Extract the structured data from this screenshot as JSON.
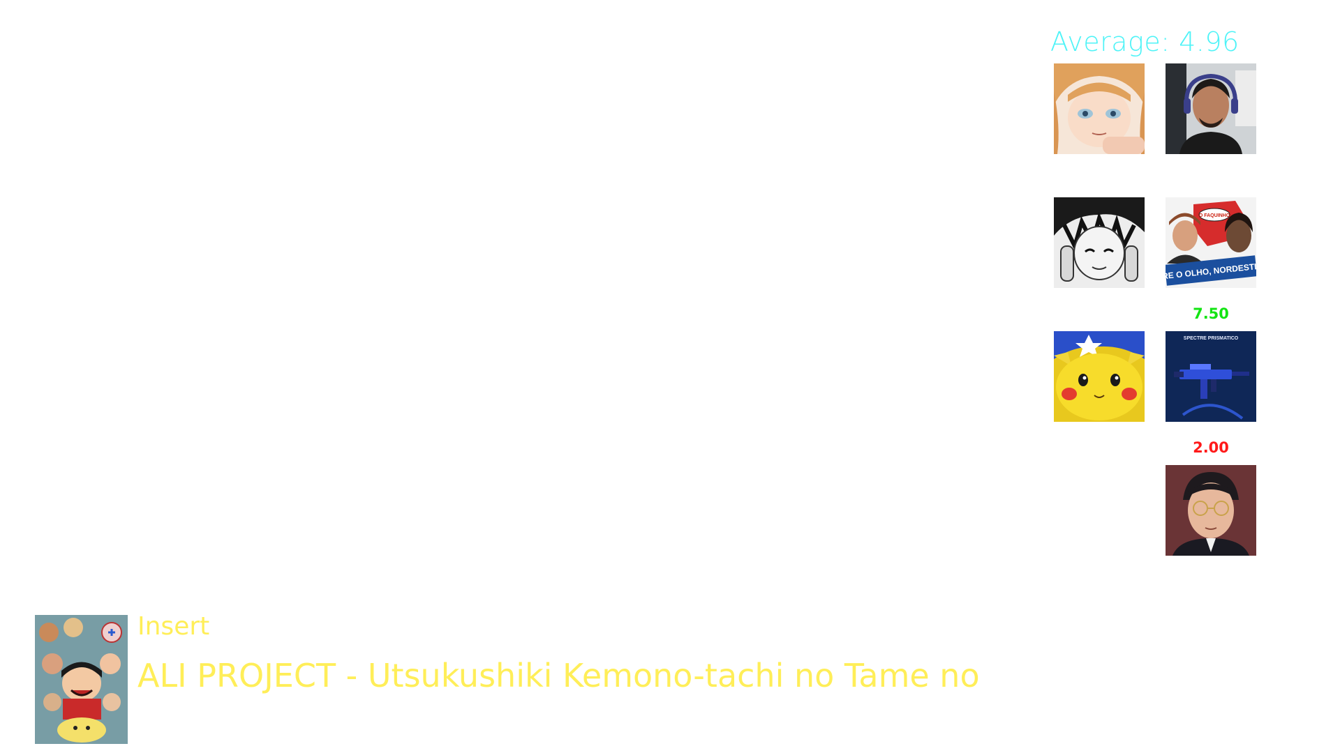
{
  "colors": {
    "average_text": "#4df3f7",
    "high_score": "#13e413",
    "low_score": "#ff1a1a",
    "song_text": "#ffee58"
  },
  "average": {
    "label": "Average: 4.96"
  },
  "voters": [
    {
      "icon": "anime-girl-avatar-icon",
      "score": ""
    },
    {
      "icon": "man-with-headphones-avatar-icon",
      "score": ""
    },
    {
      "icon": "manga-boy-avatar-icon",
      "score": ""
    },
    {
      "icon": "politician-meme-avatar-icon",
      "score": ""
    },
    {
      "icon": "pikachu-avatar-icon",
      "score": ""
    },
    {
      "icon": "blue-smg-skin-avatar-icon",
      "score": "7.50"
    },
    {
      "icon": "glasses-man-avatar-icon",
      "score": "2.00"
    }
  ],
  "meme_text": {
    "banner": "ABRE O OLHO, NORDESTINO!",
    "bubble": "O FAQUINHO"
  },
  "skin_text": {
    "label": "SPECTRE PRISMATICO"
  },
  "song": {
    "cover_icon": "one-piece-cover-icon",
    "type": "Insert",
    "title": "ALI PROJECT - Utsukushiki Kemono-tachi no Tame no"
  }
}
